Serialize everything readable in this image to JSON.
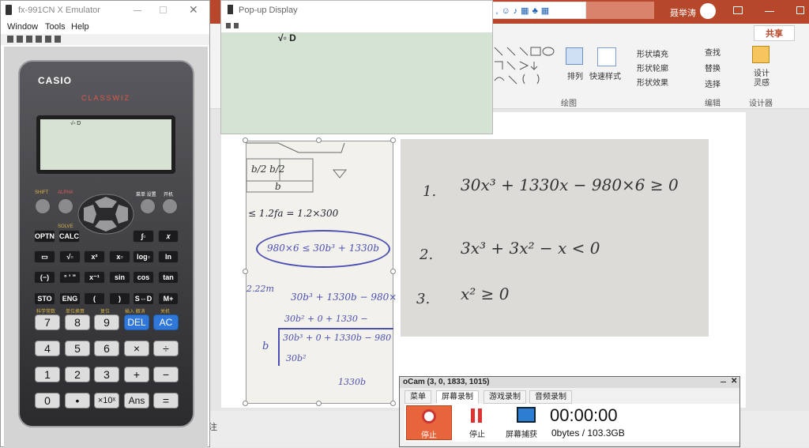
{
  "emulator": {
    "title": "fx-991CN X Emulator",
    "menu": [
      "Window",
      "Tools",
      "Help"
    ],
    "brand": "CASIO",
    "model": "CLASSWIZ",
    "display": "√▫ D",
    "keys": {
      "shift": "SHIFT",
      "alpha": "ALPHA",
      "menu_label": "菜单 设置",
      "on_label": "开机",
      "optn": "OPTN",
      "calc": "CALC",
      "solve": "SOLVE",
      "integral": "∫▫",
      "x": "𝑥",
      "frac": "▭",
      "sqrt": "√▫",
      "sq": "x²",
      "pow": "x▫",
      "log": "log▫",
      "ln": "ln",
      "neg": "(−)",
      "dms": "° ' \"",
      "inv": "x⁻¹",
      "sin": "sin",
      "cos": "cos",
      "tan": "tan",
      "sto": "STO",
      "eng": "ENG",
      "lp": "(",
      "rp": ")",
      "sd": "S⇔D",
      "mplus": "M+",
      "n7": "7",
      "n8": "8",
      "n9": "9",
      "del": "DEL",
      "ac": "AC",
      "n4": "4",
      "n5": "5",
      "n6": "6",
      "mul": "×",
      "div": "÷",
      "n1": "1",
      "n2": "2",
      "n3": "3",
      "add": "+",
      "sub": "−",
      "n0": "0",
      "dot": "•",
      "exp": "×10ˣ",
      "ans": "Ans",
      "eq": "="
    },
    "labels": {
      "sci": "科学常数",
      "unit": "单位换算",
      "reset": "复位",
      "insert": "插入 撤消",
      "off": "关机"
    }
  },
  "popup": {
    "title": "Pop-up Display",
    "display": "√▫ D"
  },
  "ppt": {
    "share": "共享",
    "user": "聂举涛",
    "ribbon": {
      "arrange": "排列",
      "quick_styles": "快速样式",
      "shape_fill": "形状填充",
      "shape_outline": "形状轮廓",
      "shape_effects": "形状效果",
      "find": "查找",
      "replace": "替换",
      "select": "选择",
      "design_ideas": "设计\n灵感",
      "group_drawing": "绘图",
      "group_editing": "编辑",
      "group_designer": "设计器"
    },
    "notes_label": "注"
  },
  "handwriting_left": {
    "dims_1": "b/2  b/2",
    "dims_2": "b",
    "line1": "≤ 1.2fa = 1.2×300",
    "line2": "980×6 ≤ 30b³ + 1330b",
    "line3": "2.22m",
    "line4": "30b³ + 1330b − 980×",
    "line5": "30b² + 0 + 1330 −",
    "line6": "30b³ + 0 + 1330b − 980",
    "line7": "30b²",
    "line8": "1330b"
  },
  "handwriting_right": {
    "row1_num": "1.",
    "row1": "30x³ + 1330x − 980×6 ≥ 0",
    "row2_num": "2.",
    "row2": "3x³ + 3x² − x < 0",
    "row3_num": "3.",
    "row3": "x² ≥ 0"
  },
  "ocam": {
    "title": "oCam (3, 0, 1833, 1015)",
    "tabs": [
      "菜单",
      "屏幕录制",
      "游戏录制",
      "音频录制"
    ],
    "stop_label": "停止",
    "pause_label": "停止",
    "capture_label": "屏幕捕获",
    "time": "00:00:00",
    "size": "0bytes / 103.3GB"
  },
  "colors": {
    "ppt_accent": "#b7472a",
    "casio_blue": "#2f77d8",
    "calc_body": "#3a3a3d",
    "lcd": "#d8e2d4",
    "ocam_stop": "#e8653b"
  }
}
